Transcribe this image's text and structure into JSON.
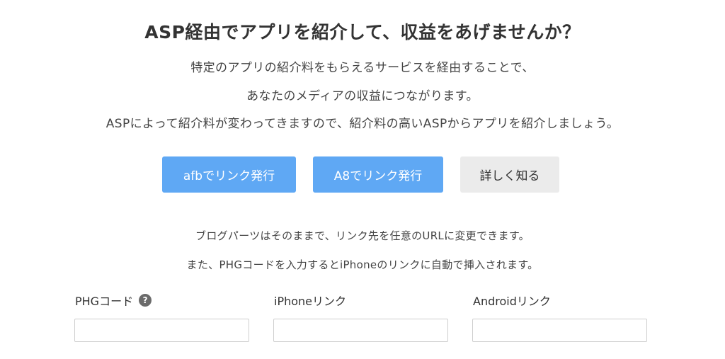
{
  "heading": "ASP経由でアプリを紹介して、収益をあげませんか？",
  "description": {
    "line1": "特定のアプリの紹介料をもらえるサービスを経由することで、",
    "line2": "あなたのメディアの収益につながります。",
    "line3": "ASPによって紹介料が変わってきますので、紹介料の高いASPからアプリを紹介しましょう。"
  },
  "buttons": {
    "afb": "afbでリンク発行",
    "a8": "A8でリンク発行",
    "more": "詳しく知る"
  },
  "notes": {
    "line1": "ブログパーツはそのままで、リンク先を任意のURLに変更できます。",
    "line2": "また、PHGコードを入力するとiPhoneのリンクに自動で挿入されます。"
  },
  "fields": {
    "phg": {
      "label": "PHGコード",
      "help": "?",
      "value": "",
      "placeholder": ""
    },
    "iphone": {
      "label": "iPhoneリンク",
      "value": "",
      "placeholder": ""
    },
    "android": {
      "label": "Androidリンク",
      "value": "",
      "placeholder": ""
    }
  },
  "colors": {
    "primary_button": "#5fa8f4",
    "secondary_button": "#ebebeb",
    "help_icon": "#6b6b6b",
    "text": "#333333"
  }
}
